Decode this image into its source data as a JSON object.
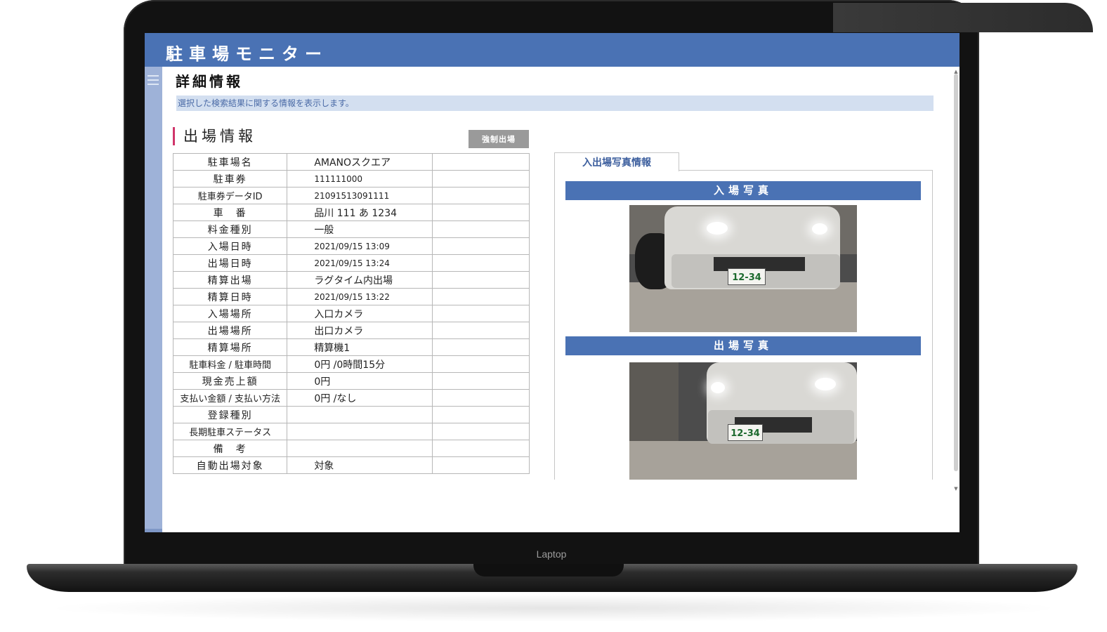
{
  "device": {
    "brand_label": "Laptop"
  },
  "app": {
    "title": "駐車場モニター"
  },
  "page": {
    "title": "詳細情報",
    "notice": "選択した検索結果に関する情報を表示します。"
  },
  "section": {
    "title": "出場情報",
    "force_exit_label": "強制出場"
  },
  "info_rows": [
    {
      "label": "駐車場名",
      "value": "AMANOスクエア"
    },
    {
      "label": "駐車券",
      "value": "111111000"
    },
    {
      "label": "駐車券データID",
      "value": "21091513091111"
    },
    {
      "label": "車　番",
      "value": "品川 111 あ 1234"
    },
    {
      "label": "料金種別",
      "value": "一般"
    },
    {
      "label": "入場日時",
      "value": "2021/09/15 13:09"
    },
    {
      "label": "出場日時",
      "value": "2021/09/15 13:24"
    },
    {
      "label": "精算出場",
      "value": "ラグタイム内出場"
    },
    {
      "label": "精算日時",
      "value": "2021/09/15 13:22"
    },
    {
      "label": "入場場所",
      "value": "入口カメラ"
    },
    {
      "label": "出場場所",
      "value": "出口カメラ"
    },
    {
      "label": "精算場所",
      "value": "精算機1"
    },
    {
      "label": "駐車料金 / 駐車時間",
      "value": "0円 /0時間15分"
    },
    {
      "label": "現金売上額",
      "value": "0円"
    },
    {
      "label": "支払い金額 / 支払い方法",
      "value": "0円 /なし"
    },
    {
      "label": "登録種別",
      "value": ""
    },
    {
      "label": "長期駐車ステータス",
      "value": ""
    },
    {
      "label": "備　考",
      "value": ""
    },
    {
      "label": "自動出場対象",
      "value": "対象"
    }
  ],
  "photos": {
    "tab_label": "入出場写真情報",
    "entry_title": "入場写真",
    "exit_title": "出場写真",
    "entry_plate": "12-34",
    "exit_plate": "12-34"
  }
}
